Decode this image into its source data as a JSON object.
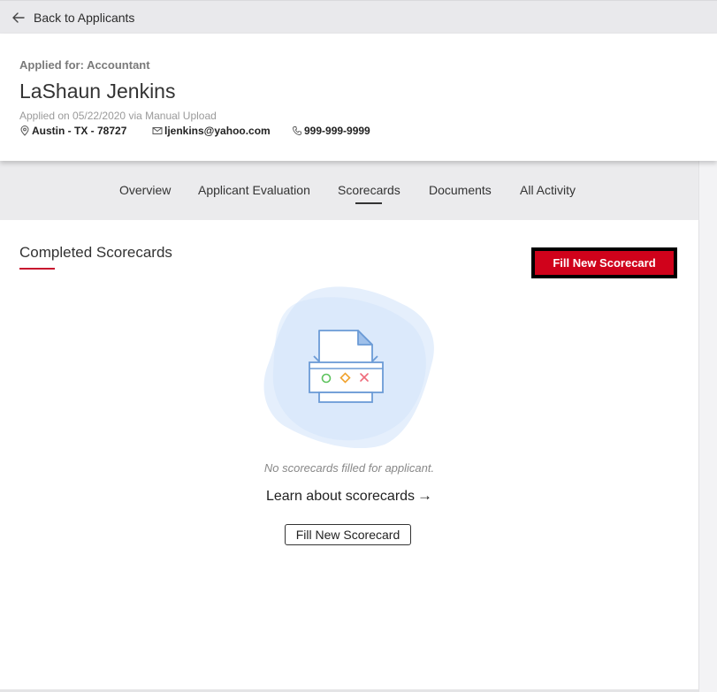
{
  "topbar": {
    "back_label": "Back to Applicants"
  },
  "header": {
    "applied_for": "Applied for: Accountant",
    "name": "LaShaun Jenkins",
    "applied_on": "Applied on 05/22/2020 via Manual Upload",
    "location": "Austin - TX - 78727",
    "email": "ljenkins@yahoo.com",
    "phone": "999-999-9999"
  },
  "tabs": [
    {
      "label": "Overview"
    },
    {
      "label": "Applicant Evaluation"
    },
    {
      "label": "Scorecards",
      "active": true
    },
    {
      "label": "Documents"
    },
    {
      "label": "All Activity"
    }
  ],
  "main": {
    "section_title": "Completed Scorecards",
    "primary_button": "Fill New Scorecard",
    "empty_text": "No scorecards filled for applicant.",
    "learn_link": "Learn about scorecards",
    "secondary_button": "Fill New Scorecard"
  },
  "colors": {
    "accent_red": "#d0021b",
    "underline_red": "#c8102e",
    "illustration_blue": "#dce9fb",
    "icon_blue": "#6b9bd6"
  },
  "icons": {
    "back": "arrow-left-icon",
    "location": "map-pin-icon",
    "email": "envelope-icon",
    "phone": "phone-icon",
    "illustration": "printer-scorecard-icon"
  }
}
